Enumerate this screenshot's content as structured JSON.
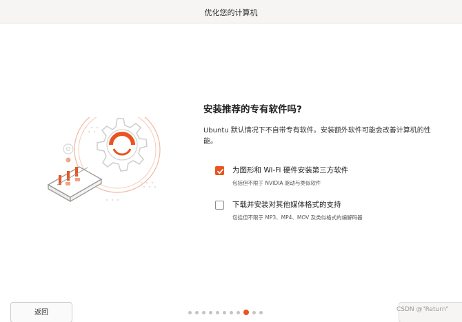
{
  "window": {
    "title": "优化您的计算机"
  },
  "main": {
    "heading": "安装推荐的专有软件吗?",
    "description": "Ubuntu 默认情况下不自带专有软件。安装额外软件可能会改善计算机的性能。"
  },
  "options": [
    {
      "label": "为图形和 Wi-Fi 硬件安装第三方软件",
      "sublabel": "包括但不限于 NVIDIA 驱动与类似软件",
      "checked": true
    },
    {
      "label": "下载并安装对其他媒体格式的支持",
      "sublabel": "包括但不限于 MP3、MP4、MOV 及类似格式的编解码器",
      "checked": false
    }
  ],
  "footer": {
    "back_label": "返回",
    "watermark": "CSDN @\"Return\"",
    "pager": {
      "total": 11,
      "active_index": 8
    }
  },
  "colors": {
    "accent": "#e95420",
    "gear": "#d0cfcd",
    "inactive_dot": "#c6c3c0"
  },
  "icons": {
    "checkbox_checked": "checkmark-icon",
    "illustration": "gear-hardware-illustration"
  }
}
